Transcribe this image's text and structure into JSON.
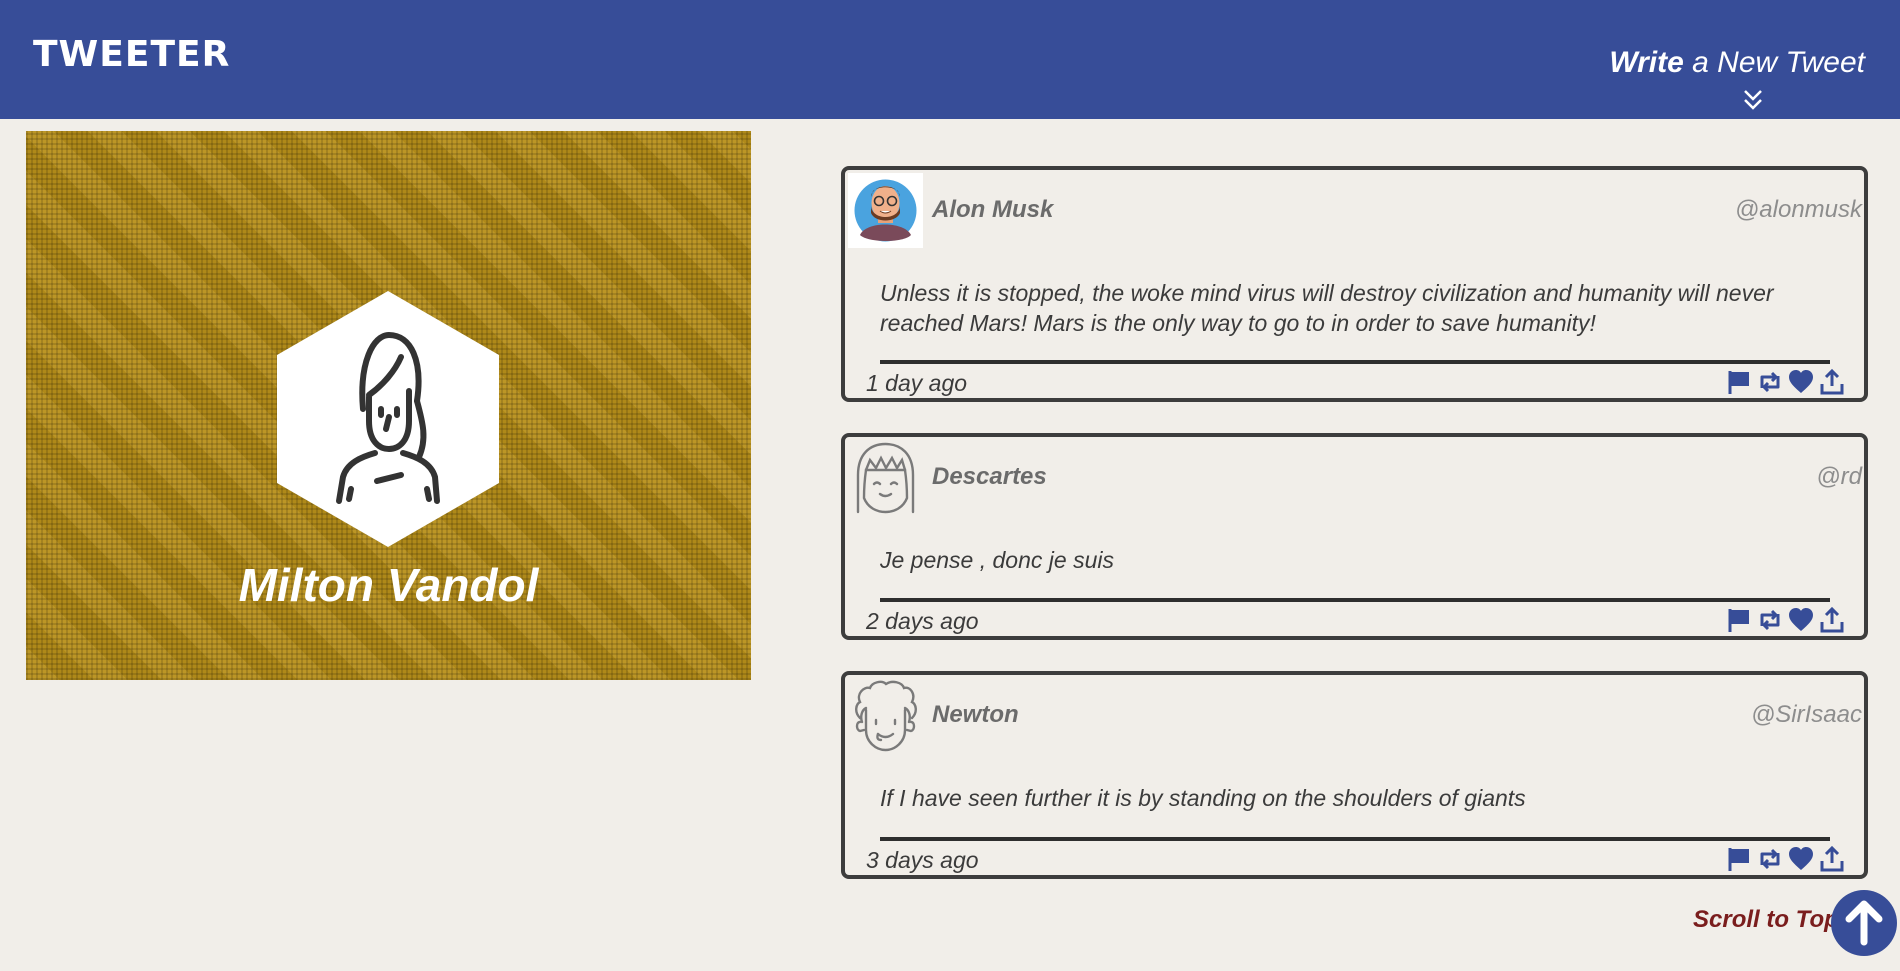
{
  "header": {
    "brand": "TWEETER",
    "write_strong": "Write",
    "write_rest": " a New Tweet",
    "chevron_icon": "double-chevron-down-icon"
  },
  "profile": {
    "name": "Milton Vandol",
    "avatar_icon": "woman-avatar-icon"
  },
  "tweets": [
    {
      "author": "Alon Musk",
      "handle": "@alonmusk",
      "content": "Unless it is stopped, the woke mind virus will destroy civilization and humanity will never reached Mars! Mars is the only way to go to in order to save humanity!",
      "time": "1 day ago",
      "avatar_icon": "bearded-man-avatar-icon"
    },
    {
      "author": "Descartes",
      "handle": "@rd",
      "content": "Je pense , donc je suis",
      "time": "2 days ago",
      "avatar_icon": "girl-bangs-avatar-icon"
    },
    {
      "author": "Newton",
      "handle": "@SirIsaac",
      "content": "If I have seen further it is by standing on the shoulders of giants",
      "time": "3 days ago",
      "avatar_icon": "curly-hair-avatar-icon"
    }
  ],
  "actions": [
    "flag-icon",
    "retweet-icon",
    "heart-icon",
    "share-icon"
  ],
  "scroll_top": {
    "label": "Scroll to Top",
    "icon": "arrow-up-icon"
  },
  "colors": {
    "nav": "#374d98",
    "background": "#f1eee9",
    "profile_bg": "#b8901a",
    "accent_red": "#7a1d1d",
    "icon_blue": "#374d98"
  }
}
